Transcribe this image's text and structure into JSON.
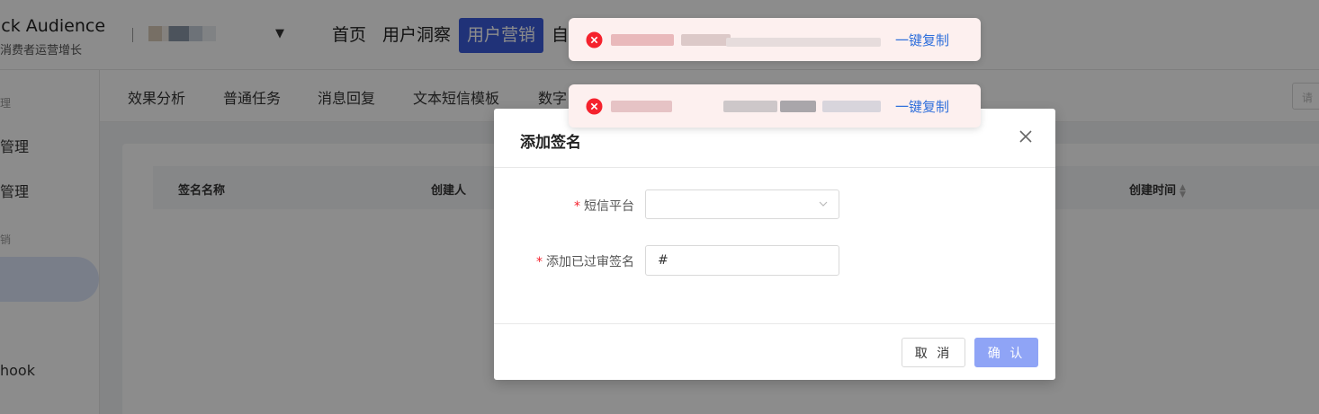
{
  "app": {
    "brand_title": "ick Audience",
    "brand_subtitle": "消费者运营增长",
    "account_caret": "▼"
  },
  "top_nav": {
    "items": [
      {
        "label": "首页",
        "active": false
      },
      {
        "label": "用户洞察",
        "active": false
      },
      {
        "label": "用户营销",
        "active": true
      },
      {
        "label": "自",
        "active": false
      }
    ]
  },
  "sidebar": {
    "groups": [
      "理",
      "销"
    ],
    "items": [
      "管理",
      "管理",
      "hook"
    ]
  },
  "sub_nav": {
    "items": [
      "效果分析",
      "普通任务",
      "消息回复",
      "文本短信模板",
      "数字"
    ],
    "search_placeholder": "请"
  },
  "table": {
    "columns": [
      "签名名称",
      "创建人",
      "创建时间"
    ]
  },
  "modal": {
    "title": "添加签名",
    "fields": {
      "platform": {
        "label": "短信平台",
        "required_mark": "*",
        "value": ""
      },
      "signature": {
        "label": "添加已过审签名",
        "required_mark": "*",
        "value": "#"
      }
    },
    "cancel_label": "取 消",
    "ok_label": "确 认"
  },
  "toasts": [
    {
      "copy_label": "一键复制"
    },
    {
      "copy_label": "一键复制"
    }
  ],
  "colors": {
    "primary": "#3b5bdb",
    "error": "#f5222d",
    "link": "#2f6fdb",
    "toast_bg": "#fdf0ef",
    "ok_button": "#8fa4f6"
  }
}
